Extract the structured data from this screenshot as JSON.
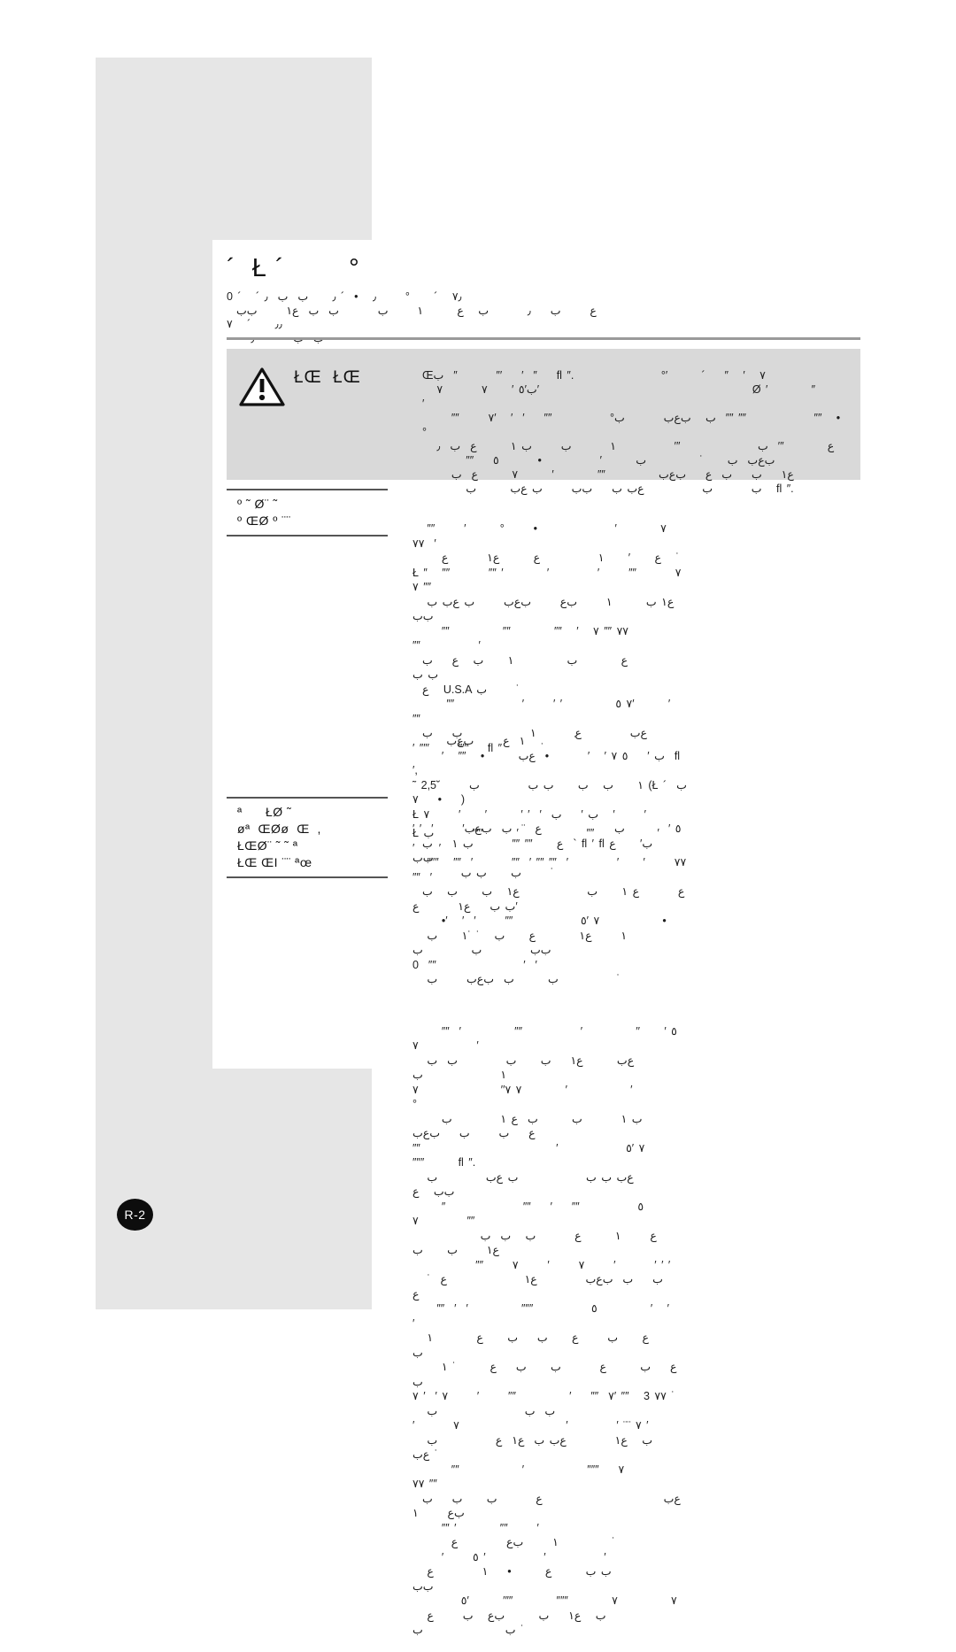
{
  "page": {
    "badge_label": "R-2",
    "panel_color": "#e6e6e6",
    "warning_panel_color": "#d9d9d9",
    "rule_color": "#9a9a9a",
    "text_color": "#1d1d1d"
  },
  "title": {
    "heading": "´  Ł ´        °",
    "subheading": "0 ´   ´ ٧٫   ´     °      ٫   •  ´ ٫     ب  ب  ٫\n  ﻉ      ﺏ    ٫        ﺏ   ﻉ       ١      ﺏ        ﺏ  ﺏ  ﻉ١      ﺏﺏ\n٫٫     ´   ٧\n     ﺏ  ﺏ        ٫"
  },
  "warning": {
    "icon_name": "warning-triangle-icon",
    "heading": "ŁŒ  ŁŒ",
    "body": "Œﺏ  ″        ″′    ′  ″    fl ″.                  °′       ´    ″   ′   ٧\n   ﺏ′٥ ′     ٧        ٧′                                            Ø ′         ″          ′\n      ″″      ﺏ   ﺏﻉﺏ        ﺏ°            ″″    ′  ′   ′٧  ″″ ″″              ″″   •      °\n   ﻉ         ″′  ﺏ                ″′            ١        ﺏ      ﺏ ١       ﻉ  ﺏ  ٫\n         ″″    ﺏﻉﺏ  ﺏ     ˙           ﺏ       ′            •        ٥\n      ﻉ١    ﺏ    ﺏ  ﻉ    ﺏﻉﺏ           ″″         ′       ٧       ﻉ  ﺏ\n         ﺏ        ﺏ            ﻉﺏ ﺏ    ﺏﺏ      ﺏ ﻉﺏ       ﺏ   fl ″."
  },
  "sections": [
    {
      "side_heading": "º ˜ Ø¨ ˜\nº ŒØ º ¨¨",
      "body": "   ″″      ′       °      •                ′         ٧       ′  ٧٧\n      ﻉ     ′     ١            ﻉ       ﻉ١        ﻉ   ˙\nŁ ″   ″″        ″″ ′         ′          ′      ٧        ″″ ″″ ٧\n   ﻉ١ ﺏ       ١      ﺏﻉ      ﺏﻉﺏ      ﺏ ﻉﺏ ﺏ                    ﺏﺏ\n      ″″           ″″         ″″   ′   ٧٧ ″″ ٧            ″″            ′\n  ﻉ         ﺏ           ١     ﺏ   ﻉ    ﺏ                         ﺏ ﺏ\n  ﻉ   U.S.A ﺏ      ˙\n       ″″              ′      ′ ′           ٧ ٥′       ′      ″″\n  ﻉﺏ          ﻉ        ١              ﺏ    ﺏ\n′ ″″′      ″″′    fl ″        ˙"
    },
    {
      "side_heading": "",
      "body": "       ١  ﻉ      ﺏﻉﺏ          ˙\n      ′   ″″   •       ﺏ ′    ٥ ٧ ′   ′        •  ﻉﺏ  fl ′,\n˜ 2,5˘      ١     ﺏ   ﺏ     ﺏ ﺏ          ﺏ (Ł ﺏ  ´ •    ٧    )\nŁ ﺏ ′    ﺏ  ′  ′ ′       ′     ′      ٧   ′      ′\n′ ′  ′      ′٥ ′         ﺏ               ﻉ  ¨  ﺏ  ﺏﻉﺏ\n  ﻉ     ″″ ″″        ﺏ ١    ﺏ  ` fl ′ fl ﺏ′     ﻉ      ﺏﺏ\n          ﺏ     ﺏ ﺏ      ˙"
    },
    {
      "side_heading": "ª      ŁØ ˜\nøª  ŒØø  Œ  ,\nŁŒØ¨ ˜ ˜ ª\nŁŒ ŒI ¨¨ ªœ",
      "body": "Ł ﺏ        ″″′       ′              ″″             ′              ′     ′\n   ″″″   ″″  ′        ″″  ′ ″″ ″″  ′          ′     ′      ٧٧ ″″  ′\n  ﻉ        ﻉ ١     ﺏ              ﻉ١   ﺏ     ﺏ   ﺏ       ﺏ ﺏ    ﻉ١        ﻉ′\n      •′   ′  ′      ″″              ٧ ′٥             •\n   ١      ﻉ١         ﻉ     ﺏ   ˙ ˙١     ﺏ         ﺏﺏ          ﺏ          ﺏ\n0  ″″                  ′  ′\n   ﺏ       ﺏ  ﺏﻉﺏ      ﺏ            ˙"
    },
    {
      "side_heading": "",
      "body": "      ″″  ′           ″″            ′           ′٥ ′     ′        ′            ٧\n   ﻉﺏ       ﻉ١    ﺏ     ﺏ          ﺏ  ﺏ                        ١                ﺏ\n٧ ٧′′                 ٧         ′             ′                       °\n      ﺏ ١        ﺏ       ﺏ  ﻉ ١          ﺏ        ﻉ    ﺏ      ﺏ    ﺏﻉﺏ\n″″                            ′              ٧ ′٥            ″″″       fl ″.\n   ﻉﺏ ﺏ ﺏ              ﺏ ﻉﺏ          ﺏ          ﺏﺏ   ﻉ\n      ″                ٥            ″″    ′    ″″                   ٧          ″″\n              ﻉ      ١       ﻉ        ﺏ   ﺏ  ﺏ    ﻉ١      ﺏ     ﺏ\n             ″″      ٧      ′      ٧      ′        ′ ′ ′\n   ﺏ    ﺏ  ﺏﻉﺏ          ﻉ١                ﻉ  ˙          ﻉ\n     ″″  ′  ′           ″″″            ٥           ′   ′         ′\n   ﻉ     ﺏ      ﻉ     ﺏ    ﺏ     ﻉ         ١         ﺏ\n      ﻉ    ﺏ       ﻉ        ﺏ     ﺏ    ﻉ       ˙ ١       ﺏ\n٧  ″″    ′           ″″      ′      ٧ ′  ′ ٧′ ″″   3 ٧٧ ˙\n   ﺏ  ﺏ                  ﺏ\n′        ٧ ¨¨ ′          ′                      ٧ ′\n   ﺏ   ﻉ١          ﻉﺏ ﺏ  ﻉ١  ﻉ            ﺏ    ﻉﺏ ˙\n        ″″             ′             ٧    ″″″                   ″″ ٧٧\n  ﻉﺏ                         ﻉ        ﺏ     ﺏ    ﺏ   ﺏﻉ      ١\n      ″″ ′         ″″      ′\n        ١      ﺏﻉ          ﻉ           ˙\n      ′      ٥ ′            ′            ′\n   ﺏ ﺏ       ﻉ       •    ١          ﻉ                 ﺏﺏ\n          ٧           ٧         ″″″         ″″′       ′٥\n   ﺏ   ﻉ١    ﺏ       ﺏﻉ   ﺏ      ﻉ                  ﺏ                 ﺏ ˙"
    }
  ]
}
